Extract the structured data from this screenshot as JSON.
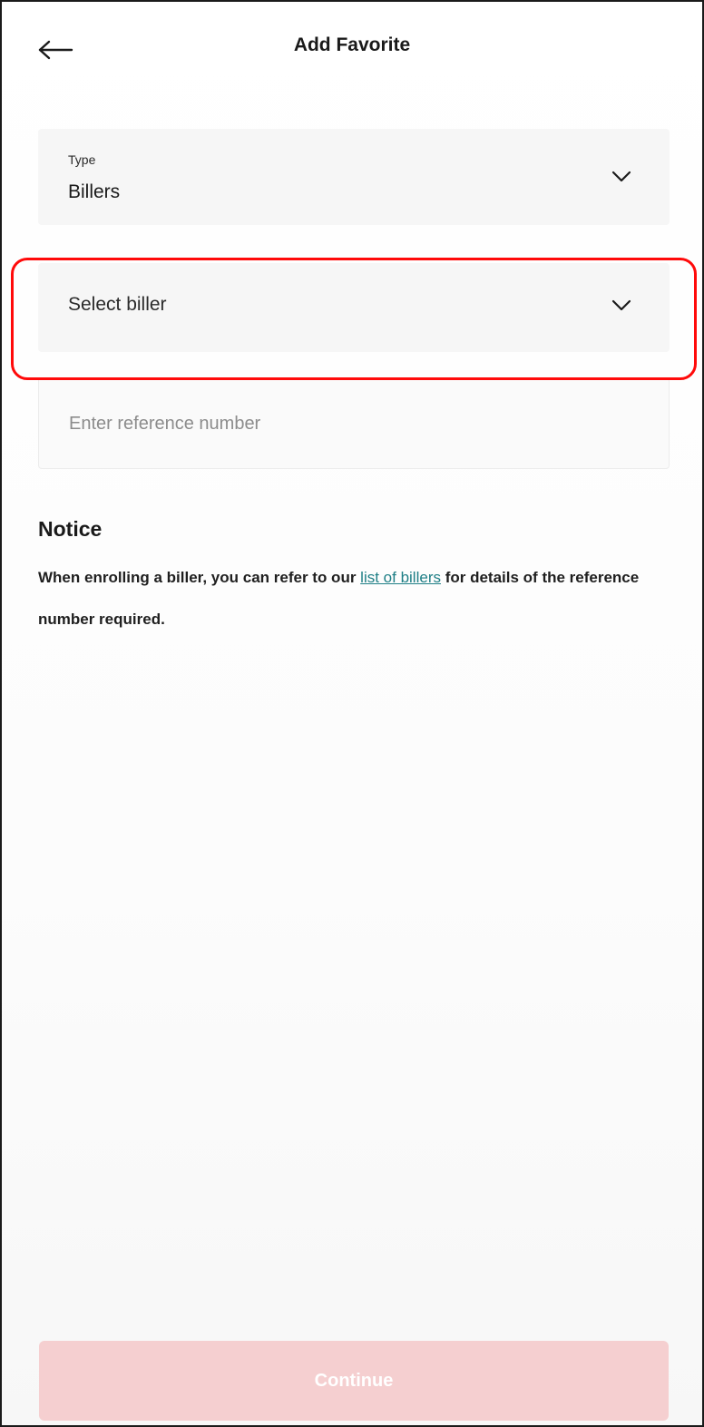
{
  "header": {
    "title": "Add Favorite",
    "back_icon": "arrow-left-icon"
  },
  "form": {
    "type_field": {
      "label": "Type",
      "value": "Billers",
      "icon": "chevron-down-icon"
    },
    "biller_field": {
      "value": "Select biller",
      "icon": "chevron-down-icon"
    },
    "reference_field": {
      "placeholder": "Enter reference number",
      "value": ""
    }
  },
  "notice": {
    "title": "Notice",
    "text_before": "When enrolling a biller, you can refer to our ",
    "link_text": "list of billers",
    "text_after": " for details of the reference number required."
  },
  "footer": {
    "continue_label": "Continue"
  },
  "colors": {
    "highlight": "#ff0a0a",
    "link": "#1f7f86",
    "button_disabled": "#f5cfd0",
    "field_bg": "#f6f6f6"
  }
}
